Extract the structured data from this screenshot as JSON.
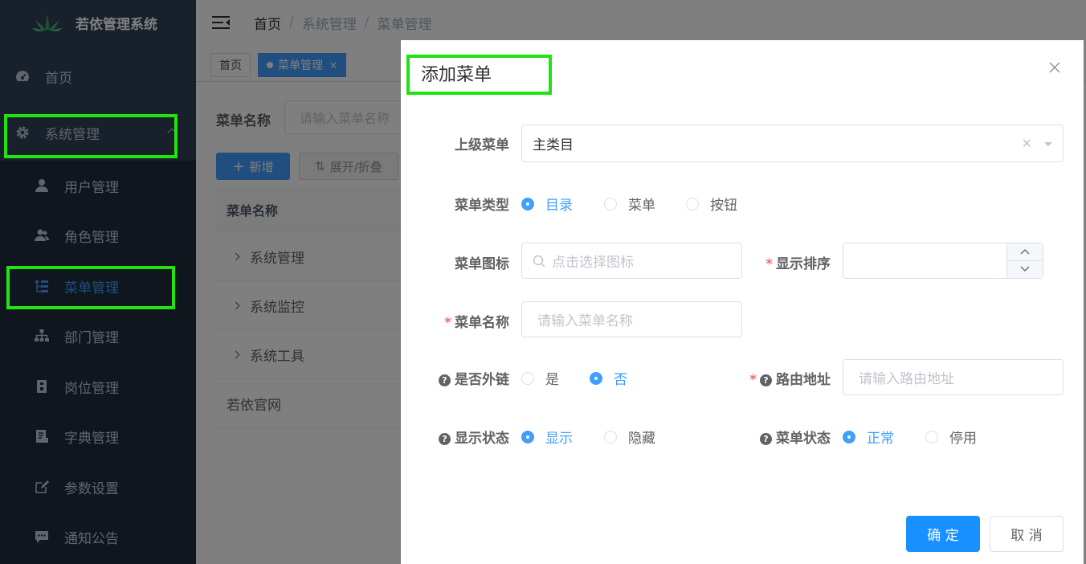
{
  "app": {
    "title": "若依管理系统"
  },
  "sidebar": {
    "home": "首页",
    "system": "系统管理",
    "items": [
      {
        "label": "用户管理",
        "icon": "user-icon"
      },
      {
        "label": "角色管理",
        "icon": "peoples-icon"
      },
      {
        "label": "菜单管理",
        "icon": "tree-table-icon"
      },
      {
        "label": "部门管理",
        "icon": "tree-icon"
      },
      {
        "label": "岗位管理",
        "icon": "post-icon"
      },
      {
        "label": "字典管理",
        "icon": "dict-icon"
      },
      {
        "label": "参数设置",
        "icon": "edit-icon"
      },
      {
        "label": "通知公告",
        "icon": "message-icon"
      }
    ]
  },
  "navbar": {
    "breadcrumb": [
      "首页",
      "系统管理",
      "菜单管理"
    ],
    "separator": "/"
  },
  "tags": {
    "home": "首页",
    "current": "菜单管理",
    "close": "×"
  },
  "search": {
    "label": "菜单名称",
    "placeholder": "请输入菜单名称"
  },
  "toolbar": {
    "add": "新增",
    "expand": "展开/折叠"
  },
  "table": {
    "header": "菜单名称",
    "rows": [
      "系统管理",
      "系统监控",
      "系统工具",
      "若依官网"
    ]
  },
  "dialog": {
    "title": "添加菜单",
    "parent": {
      "label": "上级菜单",
      "value": "主类目"
    },
    "type": {
      "label": "菜单类型",
      "options": [
        "目录",
        "菜单",
        "按钮"
      ],
      "selected": "目录"
    },
    "icon": {
      "label": "菜单图标",
      "placeholder": "点击选择图标"
    },
    "sort": {
      "label": "显示排序",
      "value": ""
    },
    "name": {
      "label": "菜单名称",
      "placeholder": "请输入菜单名称"
    },
    "external": {
      "label": "是否外链",
      "options": [
        "是",
        "否"
      ],
      "selected": "否"
    },
    "path": {
      "label": "路由地址",
      "placeholder": "请输入路由地址"
    },
    "visible": {
      "label": "显示状态",
      "options": [
        "显示",
        "隐藏"
      ],
      "selected": "显示"
    },
    "status": {
      "label": "菜单状态",
      "options": [
        "正常",
        "停用"
      ],
      "selected": "正常"
    },
    "ok": "确 定",
    "cancel": "取 消"
  },
  "colors": {
    "primary": "#409eff",
    "sidebar_bg": "#304156",
    "highlight": "#22e312"
  }
}
